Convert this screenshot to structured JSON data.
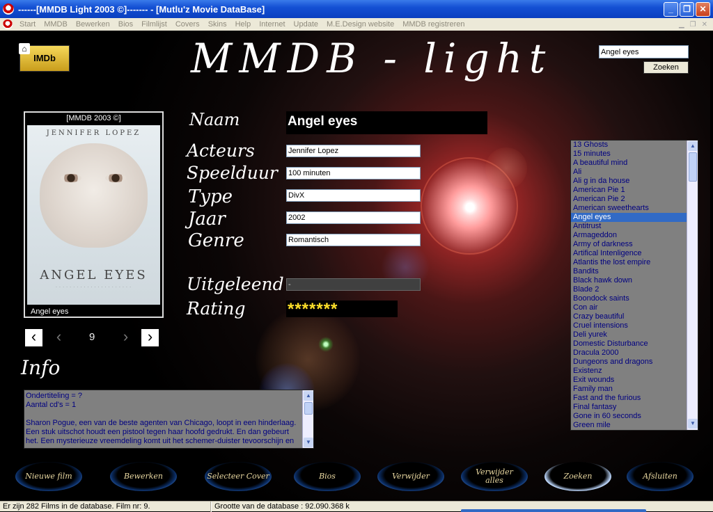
{
  "window": {
    "title": "------[MMDB Light 2003 ©]------- - [Mutlu'z Movie DataBase]"
  },
  "menu": [
    "Start",
    "MMDB",
    "Bewerken",
    "Bios",
    "Filmlijst",
    "Covers",
    "Skins",
    "Help",
    "Internet",
    "Update",
    "M.E.Design website",
    "MMDB registreren"
  ],
  "header": {
    "logo_text": "IMDb",
    "app_title": "MMDB - light",
    "search_value": "Angel eyes",
    "search_button": "Zoeken"
  },
  "poster": {
    "caption": "[MMDB 2003 ©]",
    "actor": "JENNIFER LOPEZ",
    "title": "ANGEL EYES",
    "name": "Angel eyes"
  },
  "nav": {
    "number": "9"
  },
  "labels": {
    "naam": "Naam",
    "acteurs": "Acteurs",
    "speelduur": "Speelduur",
    "type": "Type",
    "jaar": "Jaar",
    "genre": "Genre",
    "uitgeleend": "Uitgeleend",
    "rating": "Rating",
    "info": "Info"
  },
  "fields": {
    "naam": "Angel eyes",
    "acteurs": "Jennifer Lopez",
    "speelduur": "100 minuten",
    "type": "DivX",
    "jaar": "2002",
    "genre": "Romantisch",
    "uitgeleend": "-",
    "rating": "*******"
  },
  "info": {
    "line1": "Ondertiteling = ?",
    "line2": "Aantal cd's    = 1",
    "line3": "Sharon Pogue, een van de beste agenten van Chicago, loopt in een hinderlaag.",
    "line4": "Een stuk uitschot houdt een pistool tegen haar hoofd gedrukt. En dan gebeurt",
    "line5": "het. Een mysterieuze vreemdeling komt uit het schemer-duister tevoorschijn en"
  },
  "movies": [
    "13 Ghosts",
    "15 minutes",
    "A beautiful mind",
    "Ali",
    "Ali g in da house",
    "American Pie 1",
    "American Pie 2",
    "American sweethearts",
    "Angel eyes",
    "Antitrust",
    "Armageddon",
    "Army of darkness",
    "Artifical Intenligence",
    "Atlantis the lost empire",
    "Bandits",
    "Black hawk down",
    "Blade 2",
    "Boondock saints",
    "Con air",
    "Crazy beautiful",
    "Cruel intensions",
    "Deli yurek",
    "Domestic Disturbance",
    "Dracula 2000",
    "Dungeons and dragons",
    "Existenz",
    "Exit wounds",
    "Family man",
    "Fast and the furious",
    "Final fantasy",
    "Gone in 60 seconds",
    "Green mile"
  ],
  "selected_movie": "Angel eyes",
  "buttons": {
    "nieuwe_film": "Nieuwe film",
    "bewerken": "Bewerken",
    "selecteer_cover": "Selecteer Cover",
    "bios": "Bios",
    "verwijder": "Verwijder",
    "verwijder_alles_1": "Verwijder",
    "verwijder_alles_2": "alles",
    "zoeken": "Zoeken",
    "afsluiten": "Afsluiten"
  },
  "status": {
    "left": "Er zijn 282 Films in de database. Film nr: 9.",
    "right": "Grootte van de database : 92.090.368 k"
  }
}
